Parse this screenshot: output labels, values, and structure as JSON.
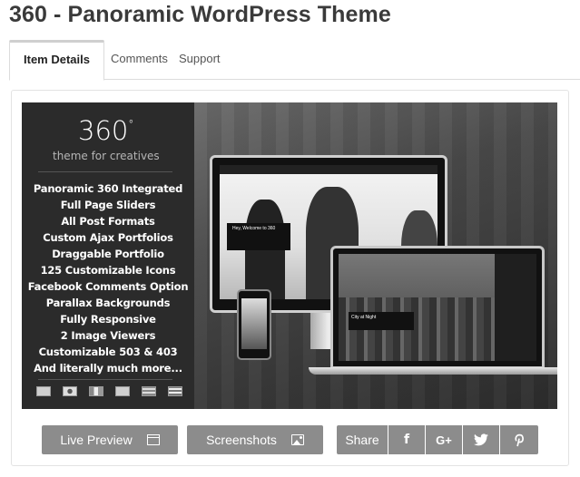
{
  "page": {
    "title": "360 - Panoramic WordPress Theme"
  },
  "tabs": [
    {
      "label": "Item Details",
      "active": true
    },
    {
      "label": "Comments",
      "active": false
    },
    {
      "label": "Support",
      "active": false
    }
  ],
  "banner": {
    "logo": "360",
    "logo_mark": "°",
    "tagline": "theme for creatives",
    "features": [
      "Panoramic 360 Integrated",
      "Full Page Sliders",
      "All Post Formats",
      "Custom Ajax Portfolios",
      "Draggable Portfolio",
      "125 Customizable Icons",
      "Facebook Comments Option",
      "Parallax Backgrounds",
      "Fully Responsive",
      "2 Image Viewers",
      "Customizable 503 & 403",
      "And literally much more..."
    ],
    "monitor_caption": "Hey, Welcome to 360",
    "laptop_caption": "City at Night"
  },
  "actions": {
    "live_preview": "Live Preview",
    "screenshots": "Screenshots",
    "share": "Share",
    "facebook_icon": "f",
    "googleplus_icon": "G+",
    "twitter_icon": "twitter-icon",
    "pinterest_icon": "pinterest-icon"
  },
  "colors": {
    "button_bg": "#8c8c8c",
    "title_color": "#3a3a3a",
    "banner_dark": "#2b2b2b"
  }
}
